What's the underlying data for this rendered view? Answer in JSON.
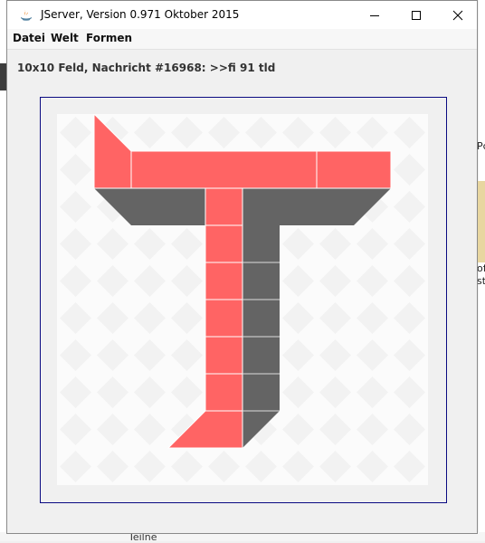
{
  "window": {
    "title": "JServer, Version 0.971 Oktober 2015"
  },
  "menu": [
    "Datei",
    "Welt",
    "Formen"
  ],
  "status": {
    "text": "10x10 Feld, Nachricht #16968: >>fi 91 tld"
  },
  "board": {
    "size": "10x10",
    "background_color": "#fbfbfb",
    "diamond_color": "#f2f2f2",
    "block_color": "#ff6464",
    "shadow_color": "#646464"
  },
  "background_app": {
    "right_texts": [
      "Pc",
      "of",
      "st"
    ],
    "bottom_text": "Teilne"
  },
  "icons": [
    "java-app-icon",
    "minimize-icon",
    "maximize-icon",
    "close-icon"
  ]
}
